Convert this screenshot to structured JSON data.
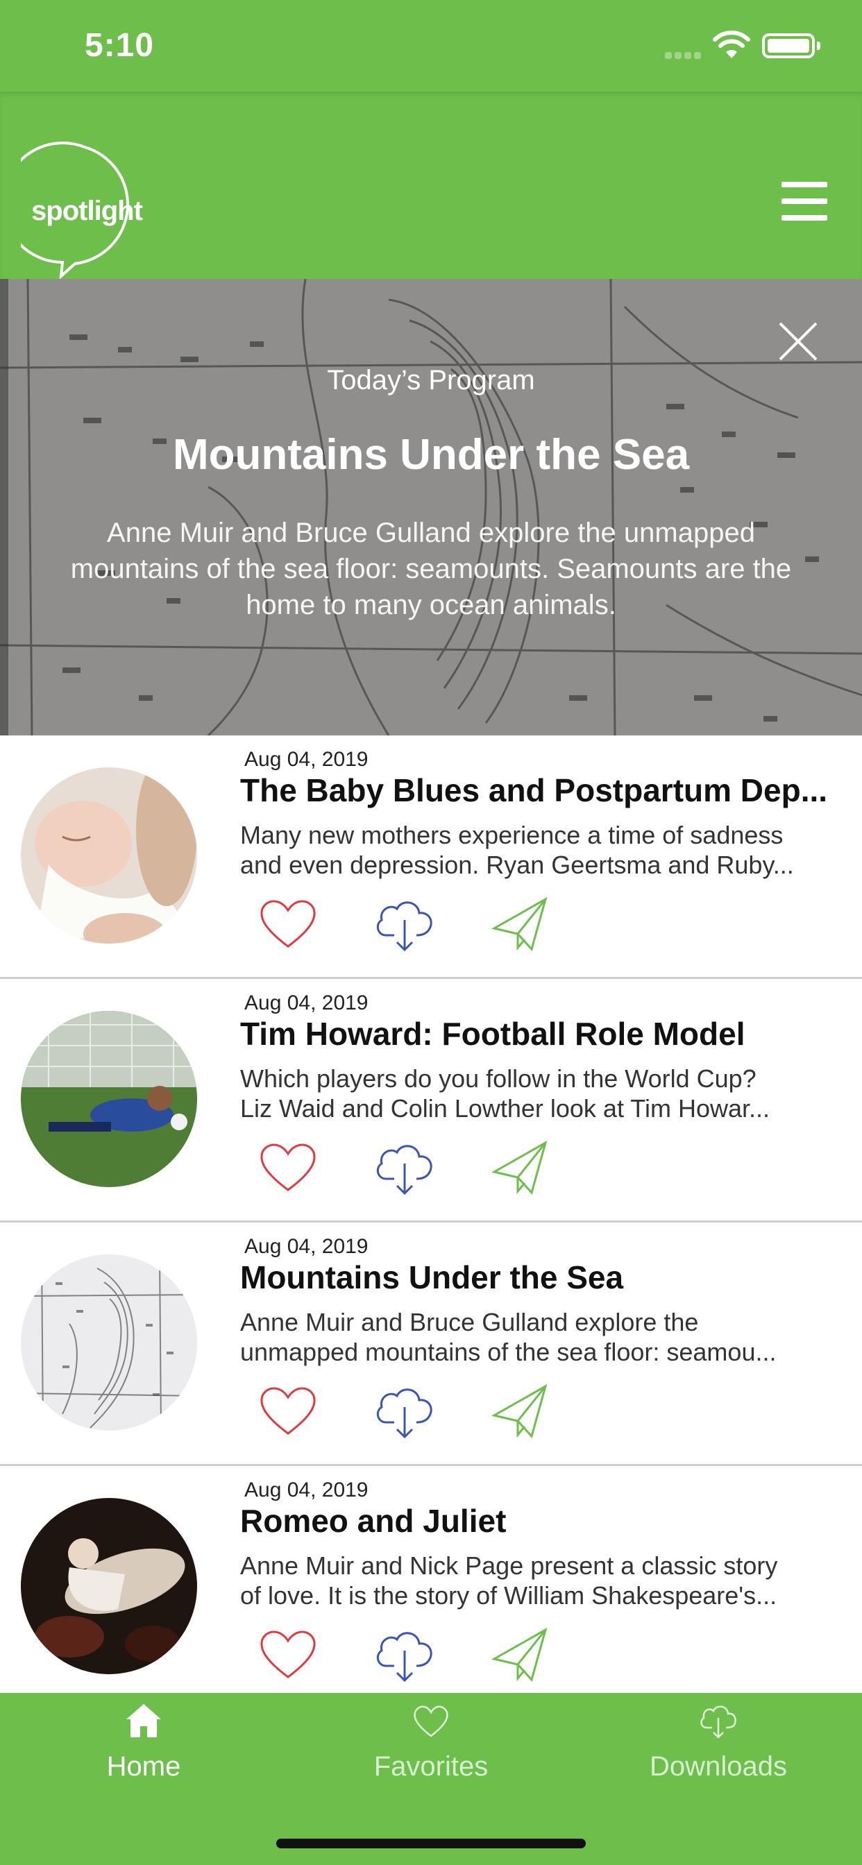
{
  "status": {
    "time": "5:10"
  },
  "header": {
    "logo_text": "spotlight",
    "brand_color": "#6dbe4b"
  },
  "hero": {
    "kicker": "Today’s Program",
    "title": "Mountains Under the Sea",
    "description": "Anne Muir and Bruce Gulland explore the unmapped mountains of the sea floor: seamounts. Seamounts are the home to many ocean animals."
  },
  "programs": [
    {
      "date": "Aug 04, 2019",
      "title": "The Baby Blues and Postpartum Dep...",
      "description_lines": [
        "Many new mothers experience a time of sadness",
        "and even depression. Ryan Geertsma and Ruby..."
      ]
    },
    {
      "date": "Aug 04, 2019",
      "title": "Tim Howard: Football Role Model",
      "description_lines": [
        "Which players do you follow in the World Cup?",
        "Liz Waid and Colin Lowther look at Tim Howar..."
      ]
    },
    {
      "date": "Aug 04, 2019",
      "title": "Mountains Under the Sea",
      "description_lines": [
        "Anne Muir and Bruce Gulland explore the",
        "unmapped mountains of the sea floor: seamou..."
      ]
    },
    {
      "date": "Aug 04, 2019",
      "title": "Romeo and Juliet",
      "description_lines": [
        "Anne Muir and Nick Page present a classic story",
        "of love. It is the story of William Shakespeare's..."
      ]
    }
  ],
  "actions": {
    "favorite_icon": "heart-icon",
    "download_icon": "cloud-download-icon",
    "share_icon": "paper-plane-icon"
  },
  "tabs": [
    {
      "label": "Home",
      "icon": "home-icon",
      "active": true
    },
    {
      "label": "Favorites",
      "icon": "heart-icon",
      "active": false
    },
    {
      "label": "Downloads",
      "icon": "cloud-download-icon",
      "active": false
    }
  ],
  "colors": {
    "green": "#6dbe4b",
    "heart": "#e0393e",
    "download": "#3a55b4",
    "share": "#6dbe4b"
  }
}
